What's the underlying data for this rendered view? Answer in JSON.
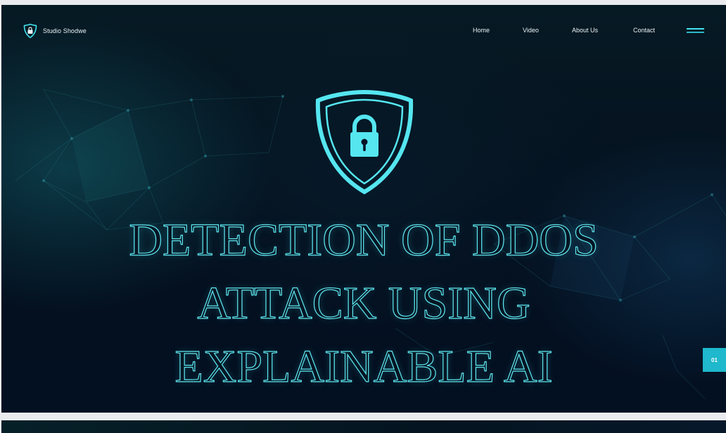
{
  "brand": {
    "name": "Studio Shodwe",
    "logo_icon": "shield-lock-icon"
  },
  "nav": {
    "items": [
      "Home",
      "Video",
      "About Us",
      "Contact"
    ],
    "menu_icon": "hamburger-menu-icon"
  },
  "hero": {
    "icon": "shield-lock-icon",
    "title_lines": [
      "DETECTION OF  DDOS",
      "ATTACK USING",
      "EXPLAINABLE AI"
    ]
  },
  "page_number": "01",
  "colors": {
    "accent": "#42e3ee",
    "background": "#041426",
    "badge": "#1fb8cc"
  }
}
